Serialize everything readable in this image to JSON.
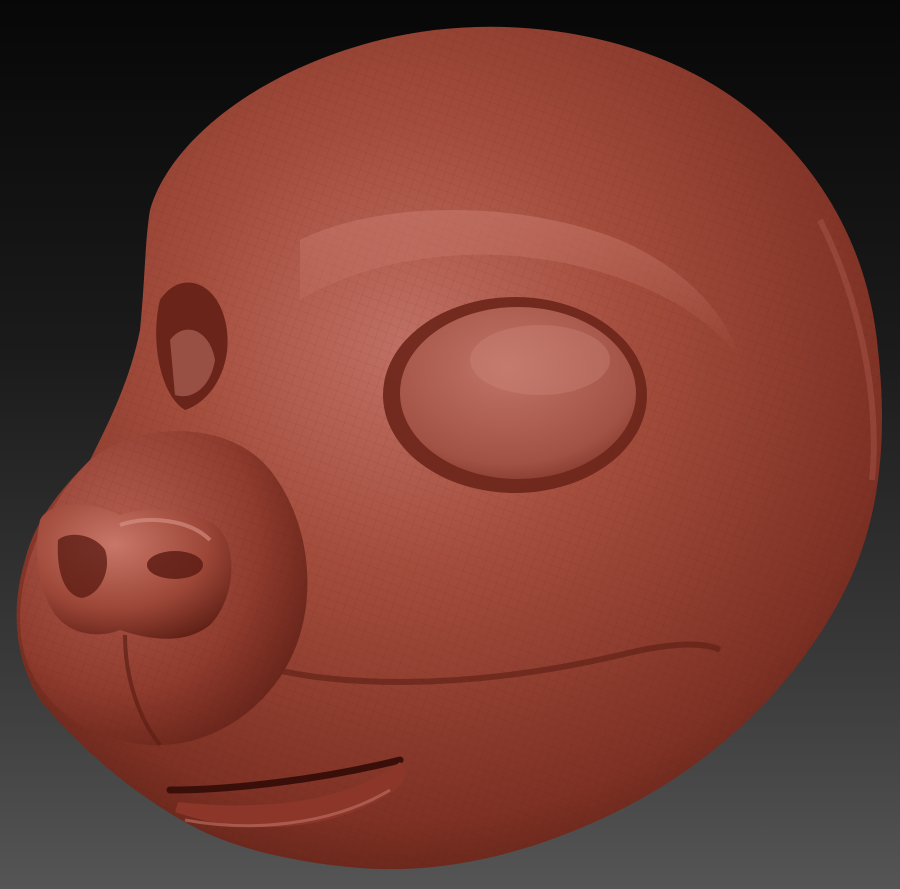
{
  "scene": {
    "subject": "sculpted-animal-head",
    "colors": {
      "background_top": "#070707",
      "background_bottom": "#555555",
      "clay_base": "#9a4434",
      "clay_light": "#c8766a",
      "clay_mid": "#a24a3a",
      "clay_shadow": "#5e1f16",
      "clay_deep": "#3a0f0a"
    }
  }
}
